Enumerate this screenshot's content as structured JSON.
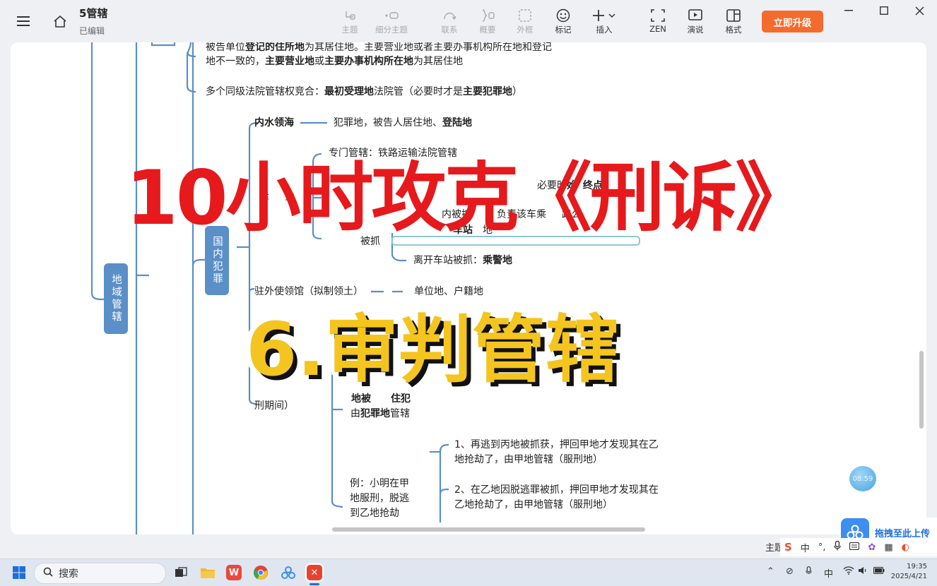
{
  "titlebar": {
    "doc_title": "5管辖",
    "doc_status": "已编辑"
  },
  "toolbar": {
    "topic": "主题",
    "subtopic": "细分主题",
    "relation": "联系",
    "summary": "概要",
    "boundary": "外框",
    "marker": "标记",
    "insert": "插入",
    "zen": "ZEN",
    "present": "演说",
    "format": "格式",
    "upgrade": "立即升级"
  },
  "mindmap": {
    "line1_a": "被告单位",
    "line1_b": "登记的住所地",
    "line1_c": "为其居住地。主要营业地或者主要办事机构所在地和登记",
    "line2_a": "地不一致的，",
    "line2_b": "主要营业地",
    "line2_c": "或",
    "line2_d": "主要办事机构所在地",
    "line2_e": "为其居住地",
    "line3_a": "多个同级法院管辖权竞合：",
    "line3_b": "最初受理地",
    "line3_c": "法院管（必要时才是",
    "line3_d": "主要犯罪地",
    "line3_e": "）",
    "inland_waters": "内水领海",
    "inland_waters_detail_a": "犯罪地，被告人居住地、",
    "inland_waters_detail_b": "登陆地",
    "special_jurisdiction": "专门管辖：铁路运输法院管辖",
    "partial_a": "必要时",
    "partial_b": "始",
    "partial_c": "终点",
    "partial_d": "非",
    "partial_e": "车",
    "partial_f": "内被抓",
    "partial_g": "负责该车乘",
    "partial_h": "路公",
    "partial_i": "车站",
    "partial_j": "地",
    "partial_k": "被抓",
    "leave_station_a": "离开车站被抓：",
    "leave_station_b": "乘警地",
    "domestic_crime": "国内犯罪",
    "territorial": "地域管辖",
    "embassy": "驻外使领馆（拟制领土）",
    "embassy_detail": "单位地、户籍地",
    "sentence_period": "刑期间）",
    "crime_place_a": "由",
    "crime_place_b": "犯罪地",
    "crime_place_c": "管辖",
    "partial_row_a": "地被",
    "partial_row_b": "住犯",
    "example_a": "例：小明在甲",
    "example_b": "地服刑，脱逃",
    "example_c": "到乙地抢劫",
    "case1_a": "1、再逃到丙地被抓获，押回甲地才发现其在乙",
    "case1_b": "地抢劫了，由甲地管辖（服刑地）",
    "case2_a": "2、在乙地因脱逃罪被抓，押回甲地才发现其在",
    "case2_b": "乙地抢劫了，由甲地管辖（服刑地）"
  },
  "overlay": {
    "headline": "10小时攻克《刑诉》",
    "chapter": "6.审判管辖"
  },
  "floating": {
    "timer": "08:59",
    "upload_label": "拖拽至此上传",
    "theme_label": "主题",
    "ime_lang": "中",
    "ime_chars": "中"
  },
  "taskbar": {
    "search": "搜索",
    "time": "19:35",
    "date": "2025/4/21"
  },
  "colors": {
    "accent_blue": "#5a8fc8",
    "overlay_red": "#e6191c",
    "overlay_yellow": "#f4c51f",
    "upgrade_orange": "#f46b2e"
  }
}
